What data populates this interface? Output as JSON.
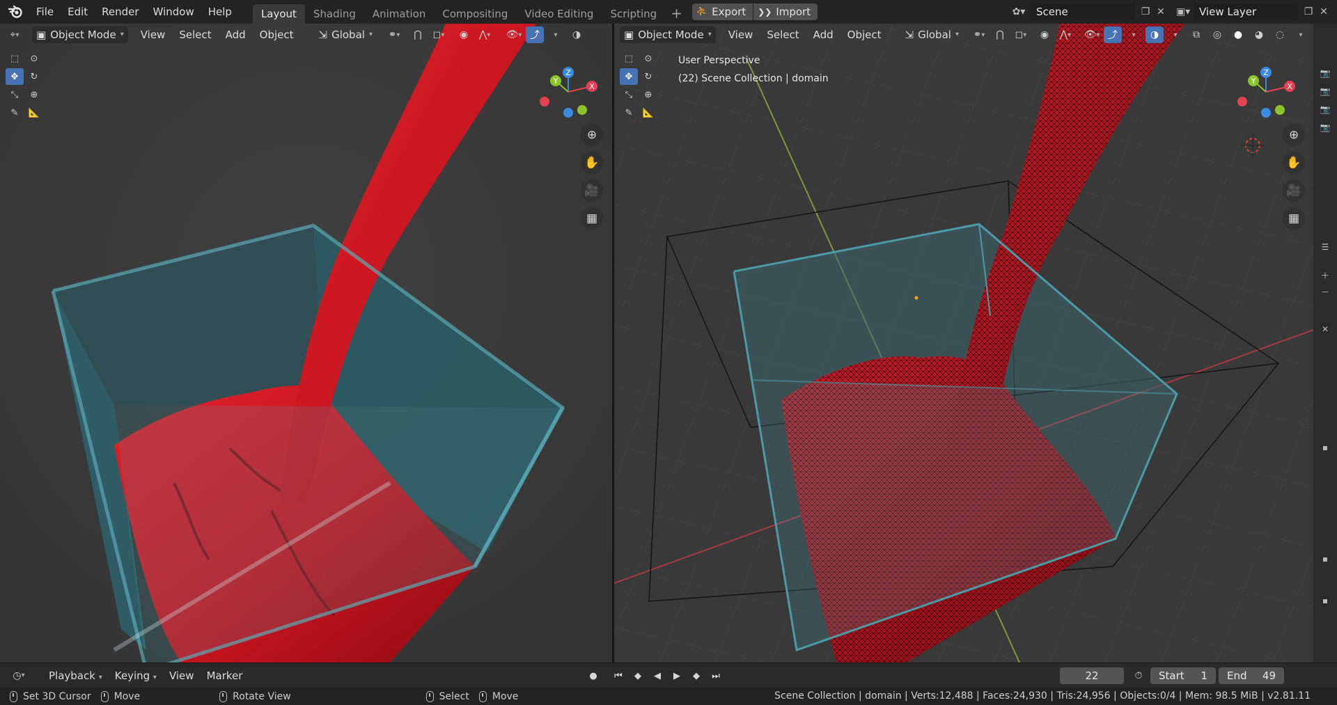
{
  "menu": [
    "File",
    "Edit",
    "Render",
    "Window",
    "Help"
  ],
  "workspaces": [
    "Layout",
    "Shading",
    "Animation",
    "Compositing",
    "Video Editing",
    "Scripting"
  ],
  "active_workspace": "Layout",
  "io": {
    "export_label": "Export",
    "import_label": "Import"
  },
  "scene_name": "Scene",
  "view_layer": "View Layer",
  "viewport_left": {
    "mode": "Object Mode",
    "menus": [
      "View",
      "Select",
      "Add",
      "Object"
    ],
    "orientation": "Global"
  },
  "viewport_right": {
    "mode": "Object Mode",
    "menus": [
      "View",
      "Select",
      "Add",
      "Object"
    ],
    "orientation": "Global",
    "info_line1": "User Perspective",
    "info_line2": "(22) Scene Collection | domain"
  },
  "gizmo_axes": {
    "x": "X",
    "y": "Y",
    "z": "Z"
  },
  "timeline": {
    "menus": [
      "Playback",
      "Keying",
      "View",
      "Marker"
    ],
    "current_frame": "22",
    "start_label": "Start",
    "start_value": "1",
    "end_label": "End",
    "end_value": "49"
  },
  "status": {
    "hint1": "Set 3D Cursor",
    "hint2": "Move",
    "hint3": "Rotate View",
    "hint4": "Select",
    "hint5": "Move",
    "stats": "Scene Collection | domain | Verts:12,488 | Faces:24,930 | Tris:24,956 | Objects:0/4 | Mem: 98.5 MiB | v2.81.11"
  },
  "colors": {
    "fluid": "#d41a24",
    "box": "#3d8b96",
    "selection": "#4772b3",
    "axis_x": "#e54250",
    "axis_y": "#8cc42c",
    "axis_z": "#3b8be0"
  }
}
